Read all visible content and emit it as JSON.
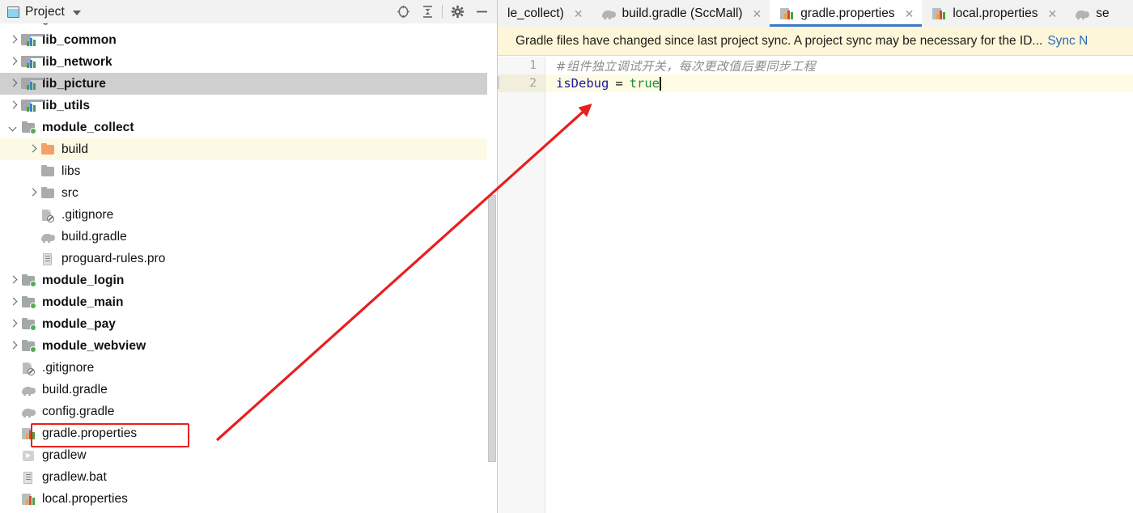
{
  "window": {
    "left_panel": {
      "title": "Project",
      "title_icon": "project-panel-icon",
      "tools": [
        {
          "name": "locate-in-tree-icon",
          "label": "Select Opened File"
        },
        {
          "name": "collapse-all-icon",
          "label": "Collapse All"
        },
        {
          "name": "gear-icon",
          "label": "Settings"
        },
        {
          "name": "minimize-icon",
          "label": "Hide"
        }
      ]
    }
  },
  "tree": {
    "items": [
      {
        "label": "gradle",
        "icon": "folder-icon",
        "indent": 1,
        "arrow": "closed",
        "bold": false,
        "state": "clipped"
      },
      {
        "label": "lib_common",
        "icon": "lib-module-icon",
        "indent": 1,
        "arrow": "closed",
        "bold": true,
        "state": "normal"
      },
      {
        "label": "lib_network",
        "icon": "lib-module-icon",
        "indent": 1,
        "arrow": "closed",
        "bold": true,
        "state": "normal"
      },
      {
        "label": "lib_picture",
        "icon": "lib-module-icon",
        "indent": 1,
        "arrow": "closed",
        "bold": true,
        "state": "selected"
      },
      {
        "label": "lib_utils",
        "icon": "lib-module-icon",
        "indent": 1,
        "arrow": "closed",
        "bold": true,
        "state": "normal"
      },
      {
        "label": "module_collect",
        "icon": "module-folder-icon",
        "indent": 1,
        "arrow": "open",
        "bold": true,
        "state": "normal"
      },
      {
        "label": "build",
        "icon": "build-folder-icon",
        "indent": 2,
        "arrow": "closed",
        "bold": false,
        "state": "excluded"
      },
      {
        "label": "libs",
        "icon": "folder-icon",
        "indent": 2,
        "arrow": "none",
        "bold": false,
        "state": "normal"
      },
      {
        "label": "src",
        "icon": "folder-icon",
        "indent": 2,
        "arrow": "closed",
        "bold": false,
        "state": "normal"
      },
      {
        "label": ".gitignore",
        "icon": "gitignore-icon",
        "indent": 2,
        "arrow": "none",
        "bold": false,
        "state": "normal"
      },
      {
        "label": "build.gradle",
        "icon": "gradle-icon",
        "indent": 2,
        "arrow": "none",
        "bold": false,
        "state": "normal"
      },
      {
        "label": "proguard-rules.pro",
        "icon": "text-file-icon",
        "indent": 2,
        "arrow": "none",
        "bold": false,
        "state": "normal"
      },
      {
        "label": "module_login",
        "icon": "module-folder-icon",
        "indent": 1,
        "arrow": "closed",
        "bold": true,
        "state": "normal"
      },
      {
        "label": "module_main",
        "icon": "module-folder-icon",
        "indent": 1,
        "arrow": "closed",
        "bold": true,
        "state": "normal"
      },
      {
        "label": "module_pay",
        "icon": "module-folder-icon",
        "indent": 1,
        "arrow": "closed",
        "bold": true,
        "state": "normal"
      },
      {
        "label": "module_webview",
        "icon": "module-folder-icon",
        "indent": 1,
        "arrow": "closed",
        "bold": true,
        "state": "normal"
      },
      {
        "label": ".gitignore",
        "icon": "gitignore-icon",
        "indent": 1,
        "arrow": "none",
        "bold": false,
        "state": "normal"
      },
      {
        "label": "build.gradle",
        "icon": "gradle-icon",
        "indent": 1,
        "arrow": "none",
        "bold": false,
        "state": "normal"
      },
      {
        "label": "config.gradle",
        "icon": "gradle-icon",
        "indent": 1,
        "arrow": "none",
        "bold": false,
        "state": "normal"
      },
      {
        "label": "gradle.properties",
        "icon": "properties-icon",
        "indent": 1,
        "arrow": "none",
        "bold": false,
        "state": "highlighted"
      },
      {
        "label": "gradlew",
        "icon": "script-icon",
        "indent": 1,
        "arrow": "none",
        "bold": false,
        "state": "normal"
      },
      {
        "label": "gradlew.bat",
        "icon": "text-file-icon",
        "indent": 1,
        "arrow": "none",
        "bold": false,
        "state": "normal"
      },
      {
        "label": "local.properties",
        "icon": "properties-icon",
        "indent": 1,
        "arrow": "none",
        "bold": false,
        "state": "normal"
      }
    ]
  },
  "tabs": [
    {
      "label": "le_collect)",
      "icon": "none",
      "active": false,
      "close": "✕"
    },
    {
      "label": "build.gradle (SccMall)",
      "icon": "gradle-icon",
      "active": false,
      "close": "✕"
    },
    {
      "label": "gradle.properties",
      "icon": "properties-icon",
      "active": true,
      "close": "✕"
    },
    {
      "label": "local.properties",
      "icon": "properties-icon",
      "active": false,
      "close": "✕"
    },
    {
      "label": "se",
      "icon": "gradle-icon",
      "active": false,
      "close": ""
    }
  ],
  "notification": {
    "message": "Gradle files have changed since last project sync. A project sync may be necessary for the ID...",
    "action_label": "Sync N"
  },
  "editor": {
    "line_numbers": [
      "1",
      "2"
    ],
    "lines": [
      {
        "type": "comment",
        "text": "#组件独立调试开关，每次更改值后要同步工程"
      },
      {
        "type": "code",
        "key": "isDebug",
        "operator": "=",
        "value": "true"
      }
    ]
  },
  "annotation": {
    "arrow_color": "#e81f1f",
    "highlight_box_color": "#e81f1f"
  },
  "colors": {
    "accent_tab": "#3a78c9",
    "notification_bg": "#fdf6d8",
    "selected_row": "#cfcfcf",
    "excluded_row": "#fcfae4"
  }
}
